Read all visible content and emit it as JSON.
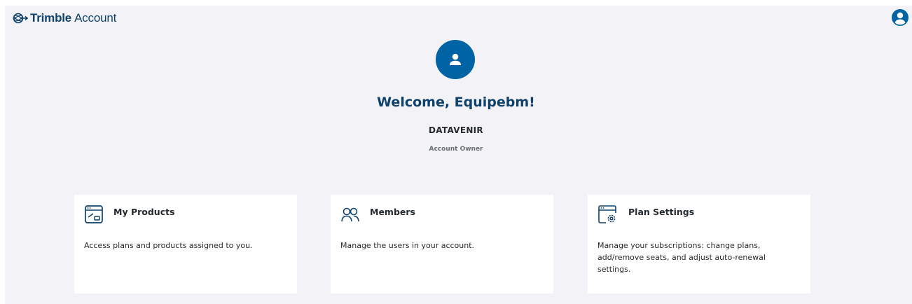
{
  "header": {
    "brand_name": "Trimble",
    "product_name": "Account",
    "logo_icon": "trimble-globe-icon",
    "profile_icon": "user-circle-icon"
  },
  "hero": {
    "avatar_icon": "user-icon",
    "welcome": "Welcome, Equipebm!",
    "organization": "DATAVENIR",
    "role": "Account Owner"
  },
  "cards": [
    {
      "icon": "product-window-icon",
      "title": "My Products",
      "description": "Access plans and products assigned to you."
    },
    {
      "icon": "users-icon",
      "title": "Members",
      "description": "Manage the users in your account."
    },
    {
      "icon": "plan-settings-gear-icon",
      "title": "Plan Settings",
      "description": "Manage your subscriptions: change plans, add/remove seats, and adjust auto-renewal settings."
    }
  ],
  "colors": {
    "brand": "#0e416c",
    "accent": "#0063a3",
    "background": "#f3f3f7",
    "card": "#ffffff",
    "text": "#252a2e",
    "muted": "#6a6e79"
  }
}
